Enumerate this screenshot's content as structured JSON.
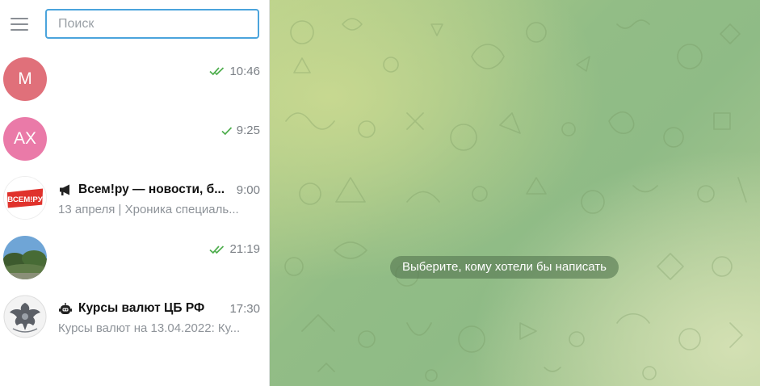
{
  "search": {
    "placeholder": "Поиск"
  },
  "colors": {
    "accent": "#4ba4dc",
    "read_check": "#4fae4e"
  },
  "chats": [
    {
      "avatar_text": "М",
      "avatar_color": "#e0707a",
      "name": "",
      "time": "10:46",
      "status": "read-double",
      "preview": ""
    },
    {
      "avatar_text": "АХ",
      "avatar_color": "#ea7aa8",
      "name": "",
      "time": "9:25",
      "status": "read-single",
      "preview": ""
    },
    {
      "avatar_logo_text": "ВСЕМ!РУ",
      "type_icon": "megaphone-icon",
      "name": "Всем!ру — новости, б...",
      "time": "9:00",
      "preview": "13 апреля | Хроника специаль..."
    },
    {
      "avatar_image": "landscape-photo",
      "name": "",
      "time": "21:19",
      "status": "read-double",
      "preview": ""
    },
    {
      "avatar_image": "bank-of-russia-emblem",
      "type_icon": "bot-icon",
      "name": "Курсы валют ЦБ РФ",
      "time": "17:30",
      "preview": "Курсы валют на 13.04.2022: Ку..."
    }
  ],
  "main": {
    "hint": "Выберите, кому хотели бы написать"
  }
}
